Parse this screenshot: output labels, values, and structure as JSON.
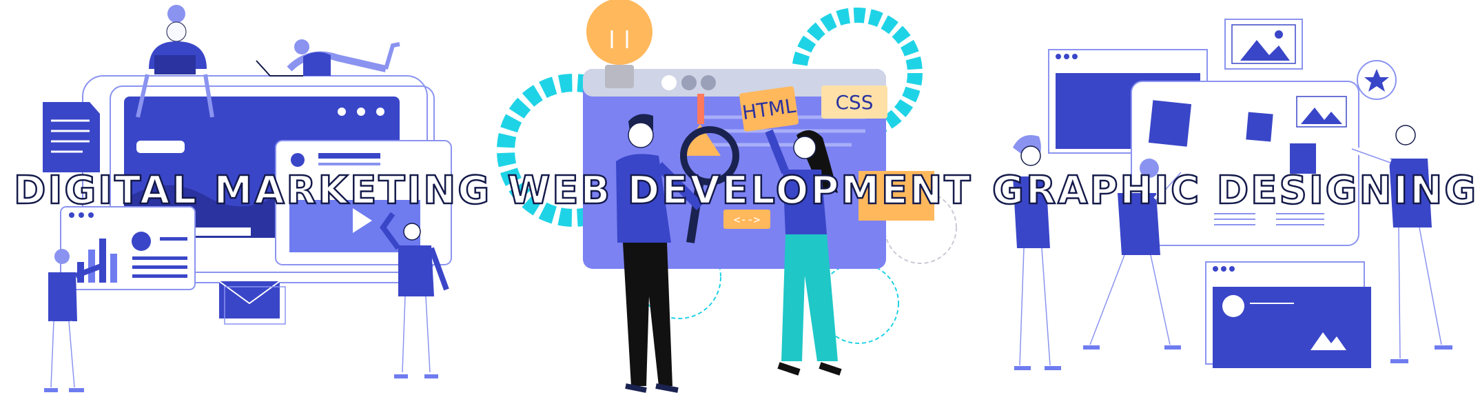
{
  "services": [
    {
      "title": "DIGITAL MARKETING"
    },
    {
      "title": "WEB DEVELOPMENT",
      "code_tags": {
        "html": "HTML",
        "css": "CSS",
        "brackets": "<-->"
      }
    },
    {
      "title": "GRAPHIC DESIGNING"
    }
  ],
  "colors": {
    "primary": "#3a46c8",
    "secondary": "#8a93f0",
    "cyan": "#1fd3e6",
    "orange": "#ffb85c",
    "outline": "#141a4a"
  }
}
